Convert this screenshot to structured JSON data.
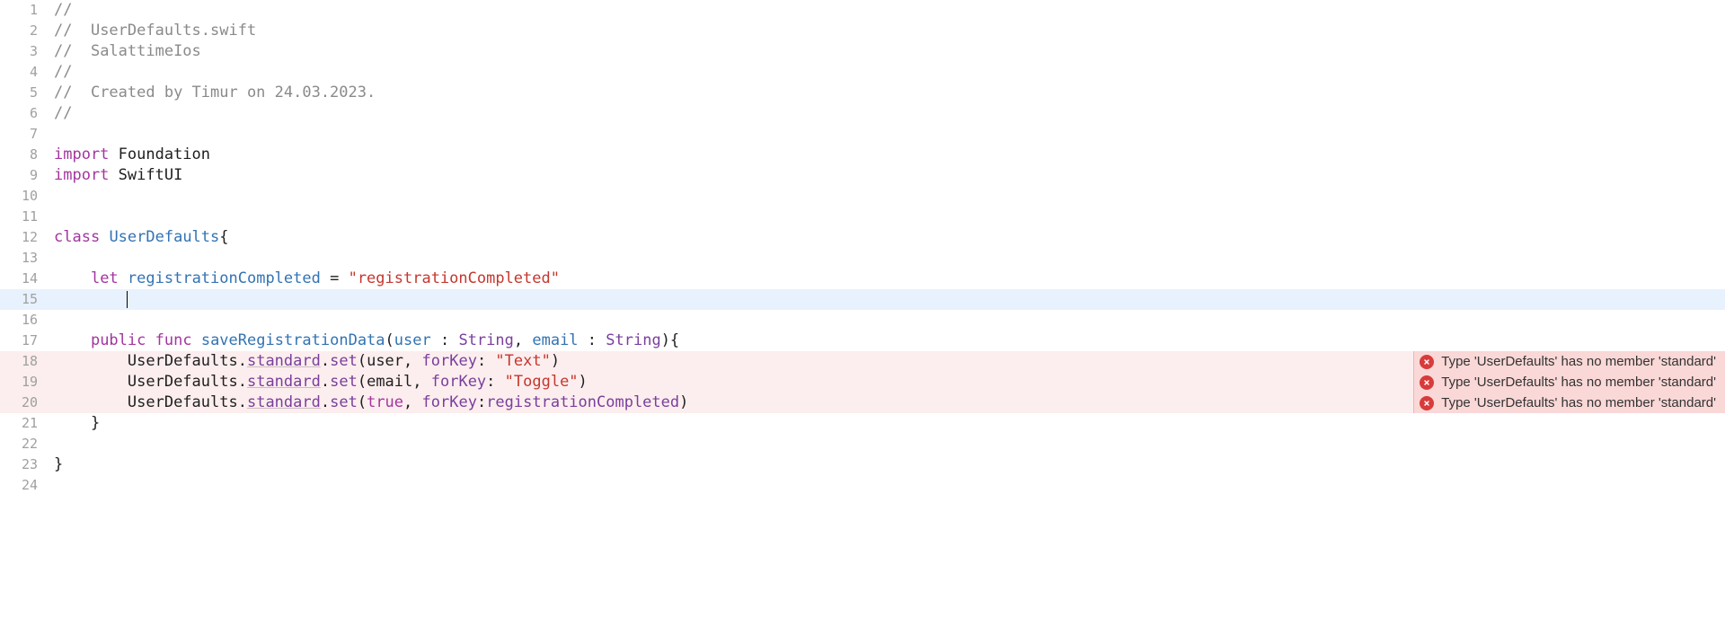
{
  "lines": {
    "l1": "//",
    "l2_c": "//  ",
    "l2_t": "UserDefaults.swift",
    "l3_c": "//  ",
    "l3_t": "SalattimeIos",
    "l4": "//",
    "l5_c": "//  ",
    "l5_t": "Created by Timur on 24.03.2023.",
    "l6": "//",
    "l7": "",
    "l8_kw": "import",
    "l8_id": " Foundation",
    "l9_kw": "import",
    "l9_id": " SwiftUI",
    "l10": "",
    "l11": "",
    "l12_kw": "class",
    "l12_sp": " ",
    "l12_name": "UserDefaults",
    "l12_b": "{",
    "l13": "",
    "l14_ind": "    ",
    "l14_kw": "let",
    "l14_sp": " ",
    "l14_name": "registrationCompleted",
    "l14_eq": " = ",
    "l14_str": "\"registrationCompleted\"",
    "l15": "    ",
    "l16": "",
    "l17_ind": "    ",
    "l17_pub": "public",
    "l17_sp1": " ",
    "l17_func": "func",
    "l17_sp2": " ",
    "l17_fname": "saveRegistrationData",
    "l17_op": "(",
    "l17_p1": "user",
    "l17_c1": " : ",
    "l17_t1": "String",
    "l17_cm": ", ",
    "l17_p2": "email",
    "l17_c2": " : ",
    "l17_t2": "String",
    "l17_cp": "){",
    "l18_ind": "        ",
    "l18_obj": "UserDefaults",
    "l18_dot1": ".",
    "l18_std": "standard",
    "l18_dot2": ".",
    "l18_set": "set",
    "l18_op": "(",
    "l18_arg1": "user",
    "l18_cm": ", ",
    "l18_fkey": "forKey",
    "l18_col": ": ",
    "l18_str": "\"Text\"",
    "l18_cp": ")",
    "l19_ind": "        ",
    "l19_obj": "UserDefaults",
    "l19_dot1": ".",
    "l19_std": "standard",
    "l19_dot2": ".",
    "l19_set": "set",
    "l19_op": "(",
    "l19_arg1": "email",
    "l19_cm": ", ",
    "l19_fkey": "forKey",
    "l19_col": ": ",
    "l19_str": "\"Toggle\"",
    "l19_cp": ")",
    "l20_ind": "        ",
    "l20_obj": "UserDefaults",
    "l20_dot1": ".",
    "l20_std": "standard",
    "l20_dot2": ".",
    "l20_set": "set",
    "l20_op": "(",
    "l20_arg1": "true",
    "l20_cm": ", ",
    "l20_fkey": "forKey",
    "l20_col": ":",
    "l20_arg2": "registrationCompleted",
    "l20_cp": ")",
    "l21_ind": "    ",
    "l21_b": "}",
    "l22": "",
    "l23": "}",
    "l24": ""
  },
  "lineNumbers": {
    "n1": "1",
    "n2": "2",
    "n3": "3",
    "n4": "4",
    "n5": "5",
    "n6": "6",
    "n7": "7",
    "n8": "8",
    "n9": "9",
    "n10": "10",
    "n11": "11",
    "n12": "12",
    "n13": "13",
    "n14": "14",
    "n15": "15",
    "n16": "16",
    "n17": "17",
    "n18": "18",
    "n19": "19",
    "n20": "20",
    "n21": "21",
    "n22": "22",
    "n23": "23",
    "n24": "24"
  },
  "errors": {
    "e18": "Type 'UserDefaults' has no member 'standard'",
    "e19": "Type 'UserDefaults' has no member 'standard'",
    "e20": "Type 'UserDefaults' has no member 'standard'"
  }
}
